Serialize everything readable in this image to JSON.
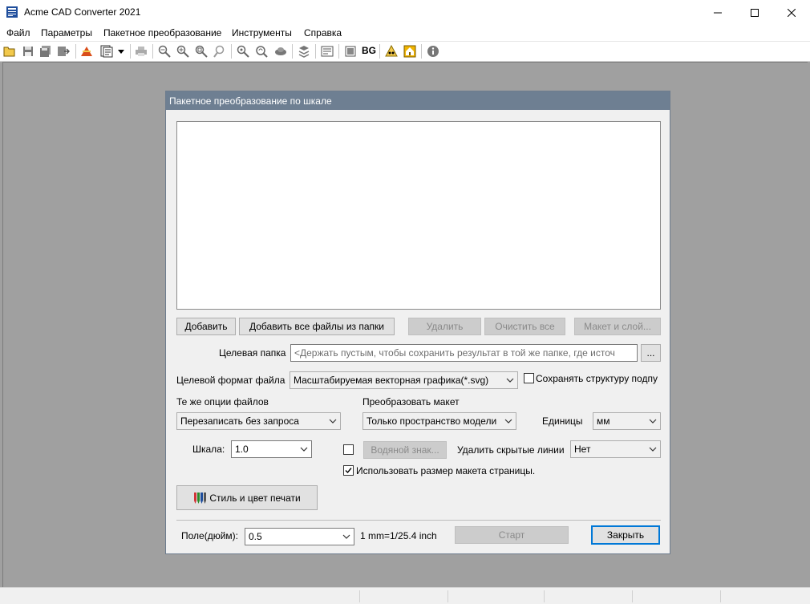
{
  "window": {
    "title": "Acme CAD Converter 2021"
  },
  "menu": [
    "Файл",
    "Параметры",
    "Пакетное преобразование",
    "Инструменты",
    "Справка"
  ],
  "toolbar": {
    "icons": [
      "open-folder-icon",
      "save-icon",
      "save-all-icon",
      "export-icon",
      "convert-icon",
      "batch-icon",
      "dropdown-arrow-icon",
      "print-icon",
      "zoom-out-icon",
      "zoom-in-icon",
      "zoom-window-icon",
      "zoom-previous-icon",
      "zoom-extents-icon",
      "zoom-realtime-icon",
      "pan-icon",
      "layers-icon",
      "layout-icon",
      "background-toggle",
      "background-text",
      "warning-icon",
      "home-icon",
      "about-icon"
    ],
    "bg_label": "BG"
  },
  "dialog": {
    "title": "Пакетное преобразование по шкале",
    "add_button": "Добавить",
    "add_folder_button": "Добавить все файлы из папки",
    "delete_button": "Удалить",
    "clear_all_button": "Очистить все",
    "layout_layer_button": "Макет и слой...",
    "target_folder_label": "Целевая папка",
    "target_folder_placeholder": "<Держать пустым, чтобы сохранить результат в той же папке, где источ",
    "browse_button": "...",
    "target_format_label": "Целевой формат файла",
    "target_format_value": "Масштабируемая векторная графика(*.svg)",
    "keep_structure_label": "Сохранять структуру подпу",
    "same_options_label": "Те же опции файлов",
    "overwrite_value": "Перезаписать без запроса",
    "convert_layout_label": "Преобразовать макет",
    "layout_value": "Только пространство модели",
    "units_label": "Единицы",
    "units_value": "мм",
    "scale_label": "Шкала:",
    "scale_value": "1.0",
    "watermark_button": "Водяной знак...",
    "remove_hidden_label": "Удалить скрытые линии",
    "remove_hidden_value": "Нет",
    "use_page_size_label": "Использовать размер макета страницы.",
    "print_style_button": "Стиль и цвет печати",
    "margin_label": "Поле(дюйм):",
    "margin_value": "0.5",
    "mm_ratio_label": "1 mm=1/25.4 inch",
    "start_button": "Старт",
    "close_button": "Закрыть"
  },
  "colors": {
    "dialog_title_bg": "#6e7f92",
    "workspace_bg": "#a0a0a0",
    "default_button_border": "#0078d7"
  }
}
